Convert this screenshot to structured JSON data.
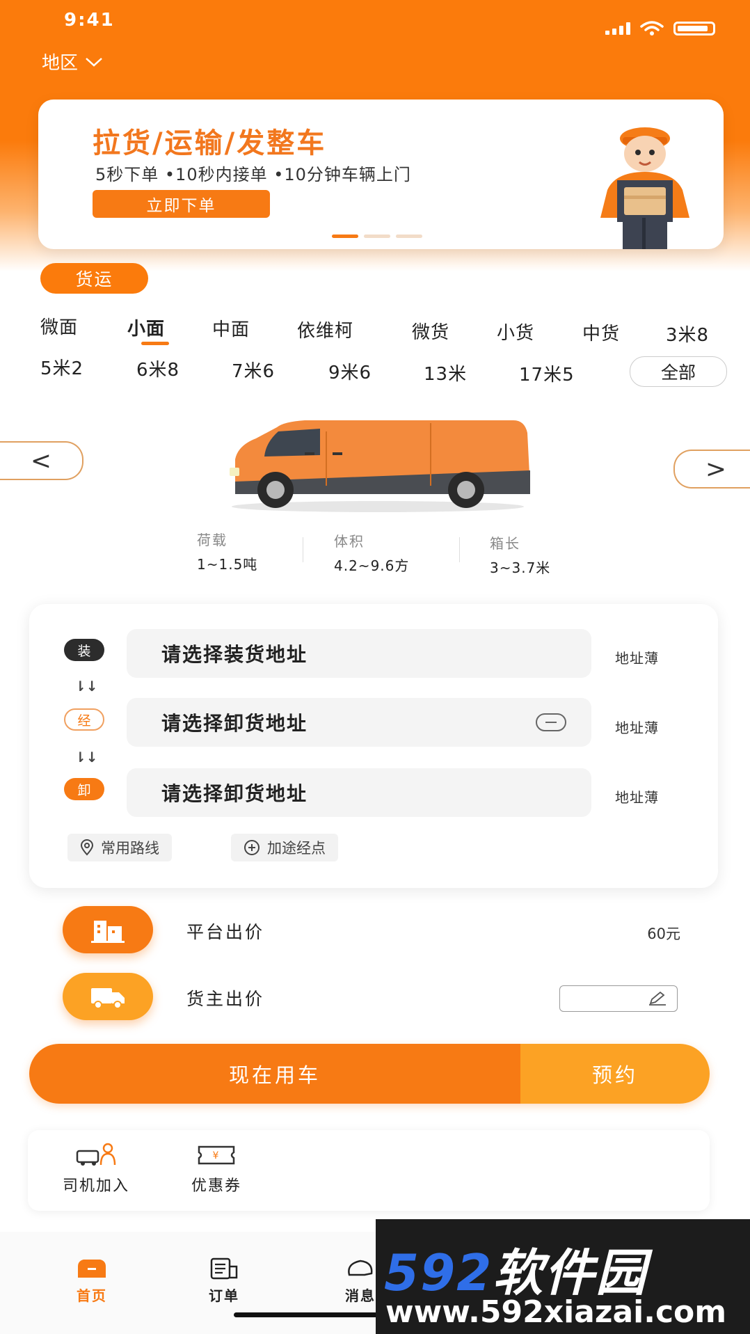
{
  "status_bar": {
    "time": "9:41"
  },
  "header": {
    "region_label": "地区"
  },
  "banner": {
    "title": "拉货/运输/发整车",
    "subtitle": "5秒下单 •10秒内接单 •10分钟车辆上门",
    "cta_label": "立即下单"
  },
  "service_chip": "货运",
  "vehicle_types": {
    "row1": [
      "微面",
      "小面",
      "中面",
      "依维柯",
      "微货",
      "小货",
      "中货",
      "3米8"
    ],
    "row2": [
      "5米2",
      "6米8",
      "7米6",
      "9米6",
      "13米",
      "17米5"
    ],
    "active": "小面",
    "all_label": "全部"
  },
  "carousel": {
    "prev": "<",
    "next": ">"
  },
  "vehicle_specs": [
    {
      "label": "荷载",
      "value": "1~1.5吨"
    },
    {
      "label": "体积",
      "value": "4.2~9.6方"
    },
    {
      "label": "箱长",
      "value": "3~3.7米"
    }
  ],
  "address": {
    "load_badge": "装",
    "via_badge": "经",
    "unload_badge": "卸",
    "connector": "⇂↓",
    "load_placeholder": "请选择装货地址",
    "via_placeholder": "请选择卸货地址",
    "unload_placeholder": "请选择卸货地址",
    "book_label": "地址薄",
    "common_routes_label": "常用路线",
    "add_stop_label": "加途经点"
  },
  "pricing": {
    "platform_label": "平台出价",
    "platform_value": "60元",
    "shipper_label": "货主出价"
  },
  "actions": {
    "now_label": "现在用车",
    "book_label": "预约"
  },
  "quick_links": [
    {
      "label": "司机加入",
      "icon": "driver-join-icon"
    },
    {
      "label": "优惠券",
      "icon": "coupon-icon"
    }
  ],
  "tabbar": [
    {
      "label": "首页",
      "icon": "home-icon"
    },
    {
      "label": "订单",
      "icon": "order-icon"
    },
    {
      "label": "消息",
      "icon": "message-icon"
    }
  ],
  "watermark": {
    "brand_num": "592",
    "brand_text": "软件园",
    "url": "www.592xiazai.com"
  },
  "colors": {
    "accent": "#f77a14",
    "accent_light": "#fca224",
    "dark": "#2c2c2c"
  }
}
